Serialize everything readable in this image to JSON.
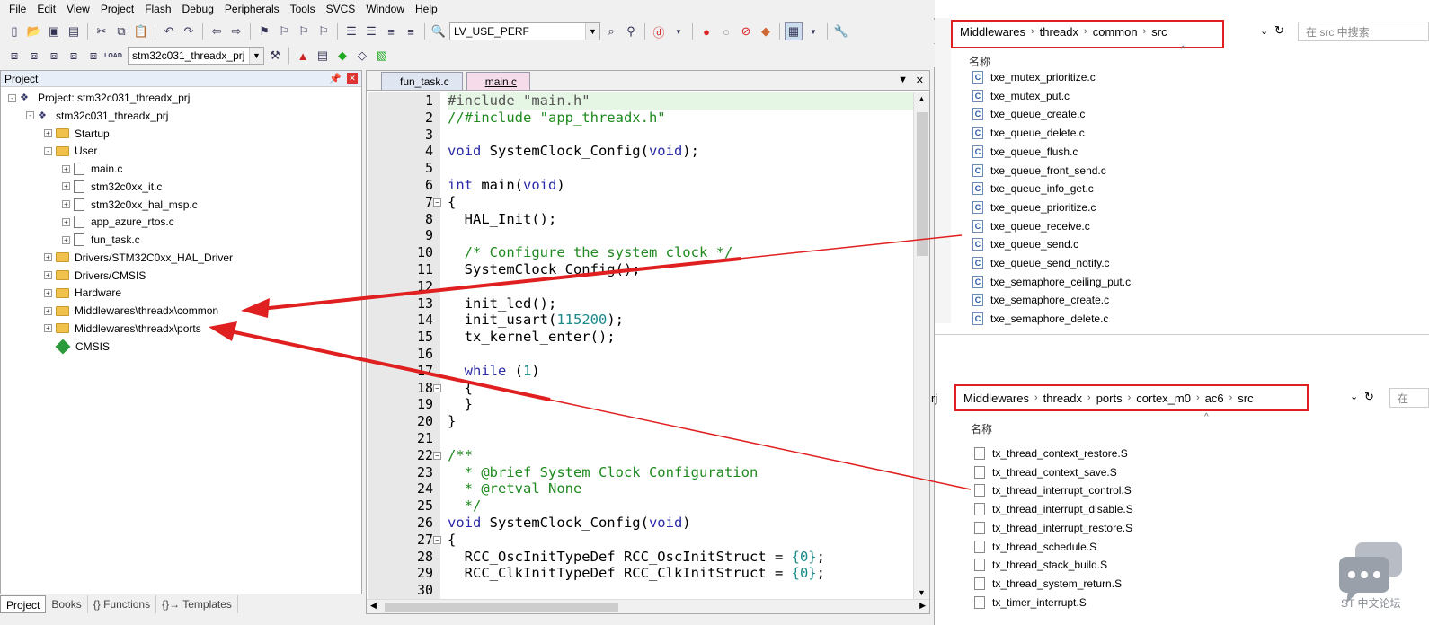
{
  "menu": [
    "File",
    "Edit",
    "View",
    "Project",
    "Flash",
    "Debug",
    "Peripherals",
    "Tools",
    "SVCS",
    "Window",
    "Help"
  ],
  "toolbar": {
    "target_define": "LV_USE_PERF",
    "target_combo": "stm32c031_threadx_prj",
    "load_label": "LOAD"
  },
  "project_panel": {
    "title": "Project",
    "tree": [
      {
        "label": "Project: stm32c031_threadx_prj",
        "level": 0,
        "type": "project",
        "expand": "-"
      },
      {
        "label": "stm32c031_threadx_prj",
        "level": 1,
        "type": "target",
        "expand": "-"
      },
      {
        "label": "Startup",
        "level": 2,
        "type": "folder",
        "expand": "+"
      },
      {
        "label": "User",
        "level": 2,
        "type": "folder",
        "expand": "-"
      },
      {
        "label": "main.c",
        "level": 3,
        "type": "file",
        "expand": "+"
      },
      {
        "label": "stm32c0xx_it.c",
        "level": 3,
        "type": "file",
        "expand": "+"
      },
      {
        "label": "stm32c0xx_hal_msp.c",
        "level": 3,
        "type": "file",
        "expand": "+"
      },
      {
        "label": "app_azure_rtos.c",
        "level": 3,
        "type": "file",
        "expand": "+"
      },
      {
        "label": "fun_task.c",
        "level": 3,
        "type": "file",
        "expand": "+"
      },
      {
        "label": "Drivers/STM32C0xx_HAL_Driver",
        "level": 2,
        "type": "folder",
        "expand": "+"
      },
      {
        "label": "Drivers/CMSIS",
        "level": 2,
        "type": "folder",
        "expand": "+"
      },
      {
        "label": "Hardware",
        "level": 2,
        "type": "folder",
        "expand": "+"
      },
      {
        "label": "Middlewares\\threadx\\common",
        "level": 2,
        "type": "folder",
        "expand": "+"
      },
      {
        "label": "Middlewares\\threadx\\ports",
        "level": 2,
        "type": "folder",
        "expand": "+"
      },
      {
        "label": "CMSIS",
        "level": 2,
        "type": "cmsis",
        "expand": ""
      }
    ],
    "bottom_tabs": [
      "Project",
      "Books",
      "{} Functions",
      "{}→ Templates"
    ]
  },
  "editor": {
    "tabs": [
      "fun_task.c",
      "main.c"
    ],
    "active_tab": "main.c",
    "lines": [
      [
        [
          "#include \"main.h\"",
          "str"
        ]
      ],
      [
        [
          "//#include \"app_threadx.h\"",
          "cm"
        ]
      ],
      [],
      [
        [
          "void",
          "kw"
        ],
        [
          " SystemClock_Config(",
          ""
        ],
        [
          "void",
          "kw"
        ],
        [
          ");",
          ""
        ]
      ],
      [],
      [
        [
          "int",
          "kw"
        ],
        [
          " main(",
          ""
        ],
        [
          "void",
          "kw"
        ],
        [
          ")",
          ""
        ]
      ],
      [
        [
          "{",
          ""
        ]
      ],
      [
        [
          "  HAL_Init();",
          ""
        ]
      ],
      [],
      [
        [
          "  /* Configure the system clock */",
          "cm"
        ]
      ],
      [
        [
          "  SystemClock_Config();",
          ""
        ]
      ],
      [],
      [
        [
          "  init_led();",
          ""
        ]
      ],
      [
        [
          "  init_usart(",
          ""
        ],
        [
          "115200",
          "num"
        ],
        [
          ");",
          ""
        ]
      ],
      [
        [
          "  tx_kernel_enter();",
          ""
        ]
      ],
      [],
      [
        [
          "  ",
          ""
        ],
        [
          "while",
          "kw"
        ],
        [
          " (",
          ""
        ],
        [
          "1",
          "num"
        ],
        [
          ")",
          ""
        ]
      ],
      [
        [
          "  {",
          ""
        ]
      ],
      [
        [
          "  }",
          ""
        ]
      ],
      [
        [
          "}",
          ""
        ]
      ],
      [],
      [
        [
          "/**",
          "cm"
        ]
      ],
      [
        [
          "  * @brief System Clock Configuration",
          "cm"
        ]
      ],
      [
        [
          "  * @retval None",
          "cm"
        ]
      ],
      [
        [
          "  */",
          "cm"
        ]
      ],
      [
        [
          "void",
          "kw"
        ],
        [
          " SystemClock_Config(",
          ""
        ],
        [
          "void",
          "kw"
        ],
        [
          ")",
          ""
        ]
      ],
      [
        [
          "{",
          ""
        ]
      ],
      [
        [
          "  RCC_OscInitTypeDef RCC_OscInitStruct = ",
          ""
        ],
        [
          "{0}",
          "num"
        ],
        [
          ";",
          ""
        ]
      ],
      [
        [
          "  RCC_ClkInitTypeDef RCC_ClkInitStruct = ",
          ""
        ],
        [
          "{0}",
          "num"
        ],
        [
          ";",
          ""
        ]
      ],
      []
    ],
    "fold_lines": [
      7,
      18,
      22,
      27
    ]
  },
  "explorer_common": {
    "path": [
      "Middlewares",
      "threadx",
      "common",
      "src"
    ],
    "search_placeholder": "在 src 中搜索",
    "column": "名称",
    "files": [
      "txe_mutex_prioritize.c",
      "txe_mutex_put.c",
      "txe_queue_create.c",
      "txe_queue_delete.c",
      "txe_queue_flush.c",
      "txe_queue_front_send.c",
      "txe_queue_info_get.c",
      "txe_queue_prioritize.c",
      "txe_queue_receive.c",
      "txe_queue_send.c",
      "txe_queue_send_notify.c",
      "txe_semaphore_ceiling_put.c",
      "txe_semaphore_create.c",
      "txe_semaphore_delete.c"
    ]
  },
  "explorer_ports": {
    "prefix": "rj",
    "path": [
      "Middlewares",
      "threadx",
      "ports",
      "cortex_m0",
      "ac6",
      "src"
    ],
    "search_placeholder": "在",
    "column": "名称",
    "files": [
      "tx_thread_context_restore.S",
      "tx_thread_context_save.S",
      "tx_thread_interrupt_control.S",
      "tx_thread_interrupt_disable.S",
      "tx_thread_interrupt_restore.S",
      "tx_thread_schedule.S",
      "tx_thread_stack_build.S",
      "tx_thread_system_return.S",
      "tx_timer_interrupt.S"
    ]
  },
  "watermark": "ST 中文论坛",
  "colors": {
    "annotation_red": "#e02020",
    "active_tab": "#f6dcea",
    "highlight_line": "#e6f6e4"
  }
}
